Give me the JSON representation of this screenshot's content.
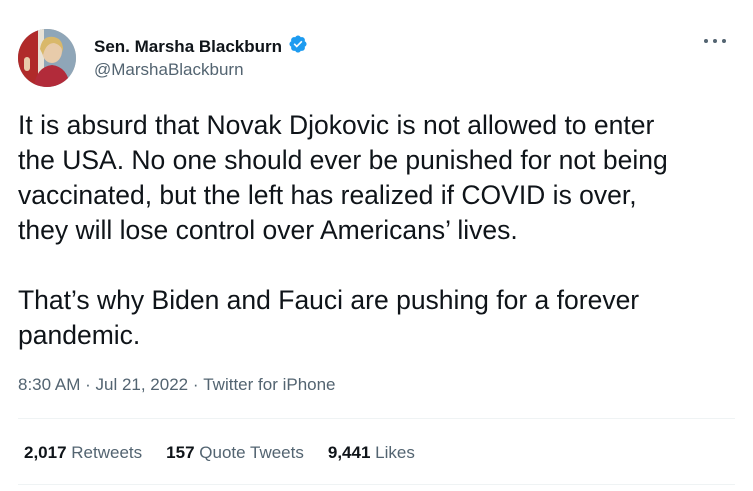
{
  "author": {
    "name": "Sen. Marsha Blackburn",
    "handle": "@MarshaBlackburn",
    "verified_color": "#1d9bf0"
  },
  "tweet": {
    "text": "It is absurd that Novak Djokovic is not allowed to enter\nthe USA. No one should ever be punished for not being\nvaccinated, but the left has realized if COVID is over,\nthey will lose control over Americans’ lives.\n\nThat’s why Biden and Fauci are pushing for a forever\npandemic.",
    "time": "8:30 AM",
    "sep1": " · ",
    "date": "Jul 21, 2022",
    "sep2": " · ",
    "source": "Twitter for iPhone"
  },
  "stats": {
    "retweets_count": "2,017",
    "retweets_label": "Retweets",
    "quotes_count": "157",
    "quotes_label": "Quote Tweets",
    "likes_count": "9,441",
    "likes_label": "Likes"
  },
  "icons": {
    "verified": "verified-badge-icon",
    "more": "more-options-icon"
  }
}
